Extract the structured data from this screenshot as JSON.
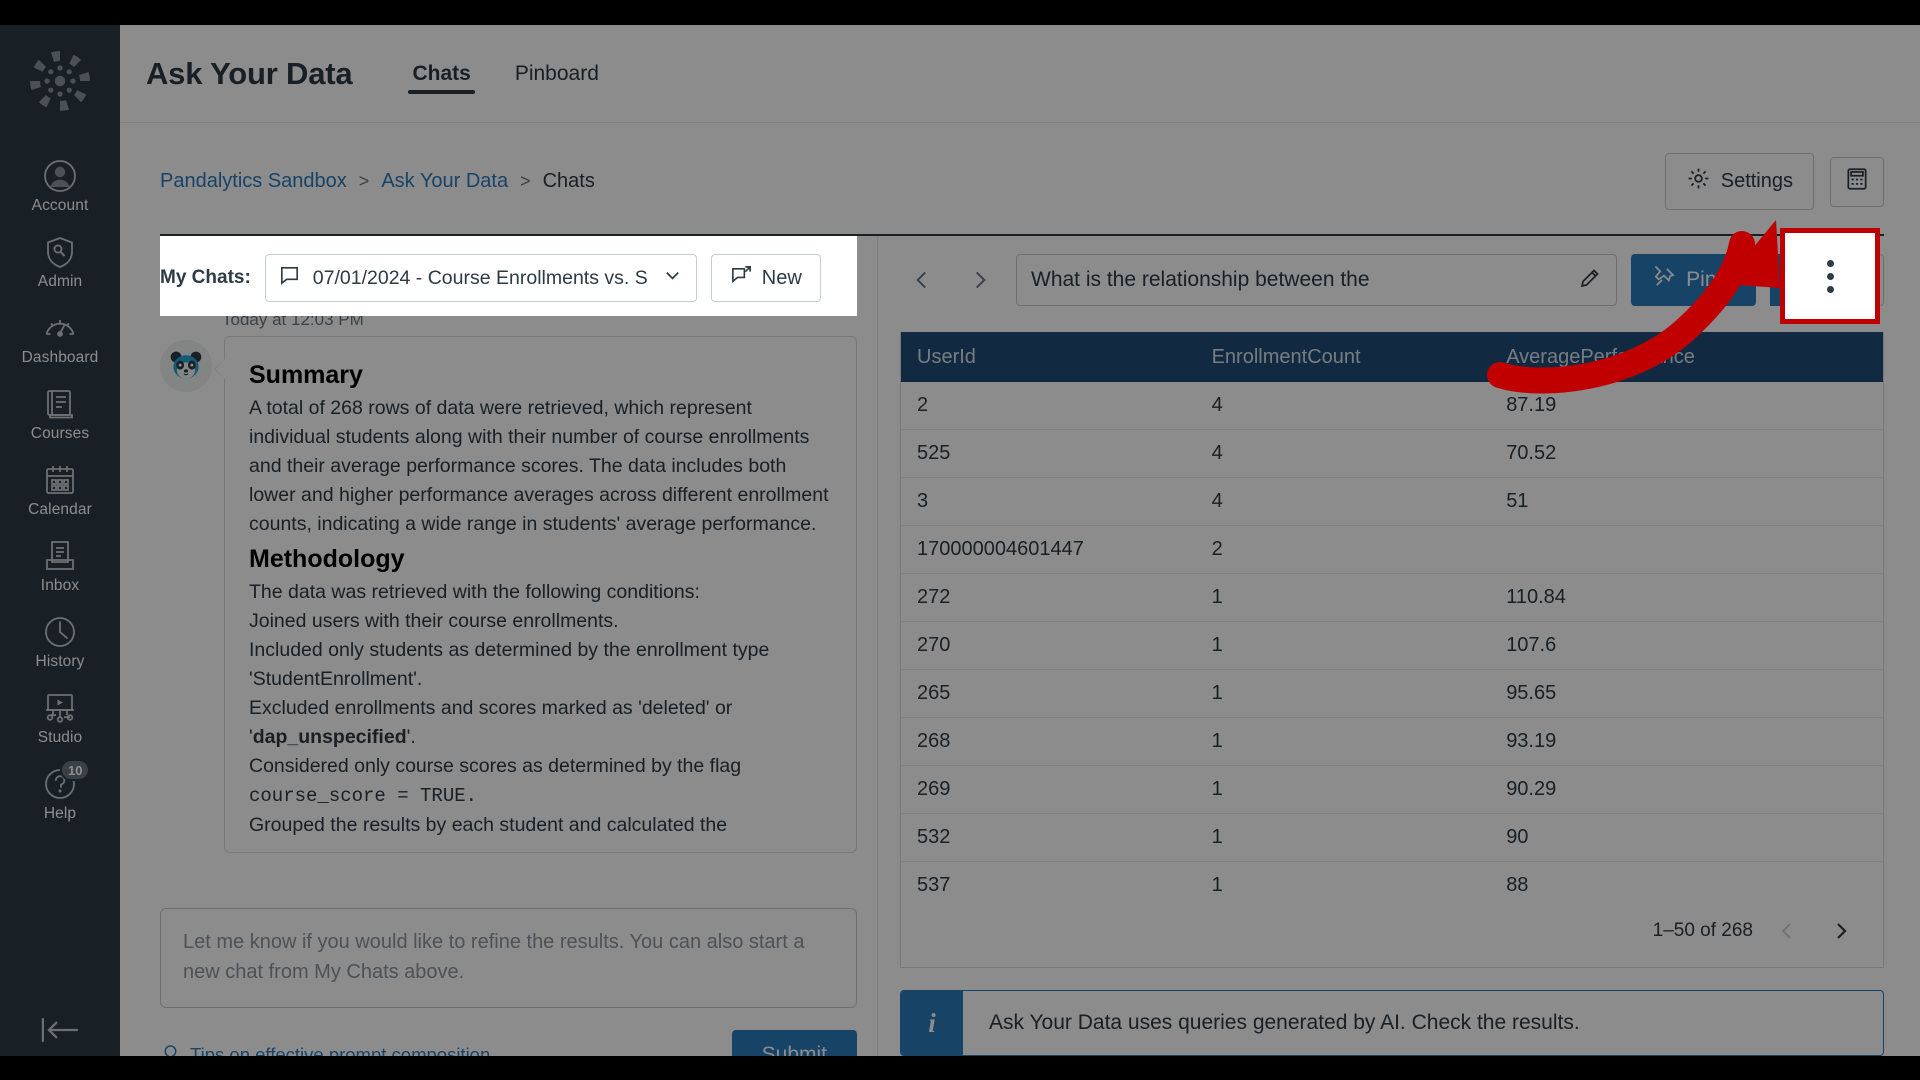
{
  "global_nav": {
    "logo_name": "canvas-logo",
    "items": [
      {
        "label": "Account",
        "icon": "user-circle-icon"
      },
      {
        "label": "Admin",
        "icon": "shield-key-icon"
      },
      {
        "label": "Dashboard",
        "icon": "gauge-icon"
      },
      {
        "label": "Courses",
        "icon": "book-icon"
      },
      {
        "label": "Calendar",
        "icon": "calendar-icon"
      },
      {
        "label": "Inbox",
        "icon": "inbox-icon"
      },
      {
        "label": "History",
        "icon": "clock-icon"
      },
      {
        "label": "Studio",
        "icon": "studio-icon"
      },
      {
        "label": "Help",
        "icon": "help-icon",
        "badge": "10"
      }
    ],
    "collapse_label": "collapse-nav-icon"
  },
  "app_header": {
    "title": "Ask Your Data",
    "tabs": [
      {
        "label": "Chats",
        "active": true
      },
      {
        "label": "Pinboard",
        "active": false
      }
    ]
  },
  "breadcrumb": {
    "items": [
      {
        "label": "Pandalytics Sandbox",
        "link": true
      },
      {
        "label": "Ask Your Data",
        "link": true
      },
      {
        "label": "Chats",
        "link": false
      }
    ],
    "separator": ">"
  },
  "header_actions": {
    "settings_label": "Settings",
    "settings_icon": "gear-icon",
    "calculator_icon": "calculator-icon"
  },
  "chat_panel": {
    "my_chats_label": "My Chats:",
    "selected_chat": "07/01/2024 - Course Enrollments vs. S",
    "chat_icon": "chat-bubble-icon",
    "dropdown_icon": "chevron-down-icon",
    "new_button_label": "New",
    "new_button_icon": "new-chat-icon",
    "message_timestamp": "Today at 12:03 PM",
    "avatar_icon": "panda-avatar",
    "message": {
      "summary_heading": "Summary",
      "summary_body": "A total of 268 rows of data were retrieved, which represent individual students along with their number of course enrollments and their average performance scores. The data includes both lower and higher performance averages across different enrollment counts, indicating a wide range in students' average performance.",
      "methodology_heading": "Methodology",
      "methodology_intro": "The data was retrieved with the following conditions:",
      "methodology_lines": [
        "Joined users with their course enrollments.",
        "Included only students as determined by the enrollment type 'StudentEnrollment'."
      ],
      "excluded_line_prefix": "Excluded enrollments and scores marked as 'deleted' or '",
      "excluded_code": "dap_unspecified",
      "excluded_line_suffix": "'.",
      "considered_line": "Considered only course scores as determined by the flag",
      "considered_code": "course_score = TRUE.",
      "grouped_line": "Grouped the results by each student and calculated the"
    },
    "composer_placeholder": "Let me know if you would like to refine the results.  You can also start a new chat from My Chats above.",
    "tips_label": "Tips on effective prompt composition",
    "tips_icon": "lightbulb-icon",
    "submit_label": "Submit"
  },
  "result_panel": {
    "prev_icon": "chevron-left-icon",
    "next_icon": "chevron-right-icon",
    "question_text": "What is the relationship between the",
    "question_edit_icon": "pencil-icon",
    "pin_label": "Pin It",
    "pin_icon": "pin-icon",
    "pin_more_icon": "chevron-down-icon",
    "kebab_icon": "kebab-menu-icon",
    "table": {
      "columns": [
        "UserId",
        "EnrollmentCount",
        "AveragePerformance"
      ],
      "rows": [
        [
          "2",
          "4",
          "87.19"
        ],
        [
          "525",
          "4",
          "70.52"
        ],
        [
          "3",
          "4",
          "51"
        ],
        [
          "170000004601447",
          "2",
          ""
        ],
        [
          "272",
          "1",
          "110.84"
        ],
        [
          "270",
          "1",
          "107.6"
        ],
        [
          "265",
          "1",
          "95.65"
        ],
        [
          "268",
          "1",
          "93.19"
        ],
        [
          "269",
          "1",
          "90.29"
        ],
        [
          "532",
          "1",
          "90"
        ],
        [
          "537",
          "1",
          "88"
        ]
      ]
    },
    "pagination": {
      "range_label": "1–50 of 268",
      "prev_icon": "chevron-left-icon",
      "next_icon": "chevron-right-icon"
    },
    "info_banner": {
      "icon": "info-icon",
      "text": "Ask Your Data uses queries generated by AI. Check the results."
    }
  },
  "annotation": {
    "arrow_color": "#C00000",
    "highlight_color": "#C00000",
    "highlighted_element": "kebab-menu-icon"
  }
}
